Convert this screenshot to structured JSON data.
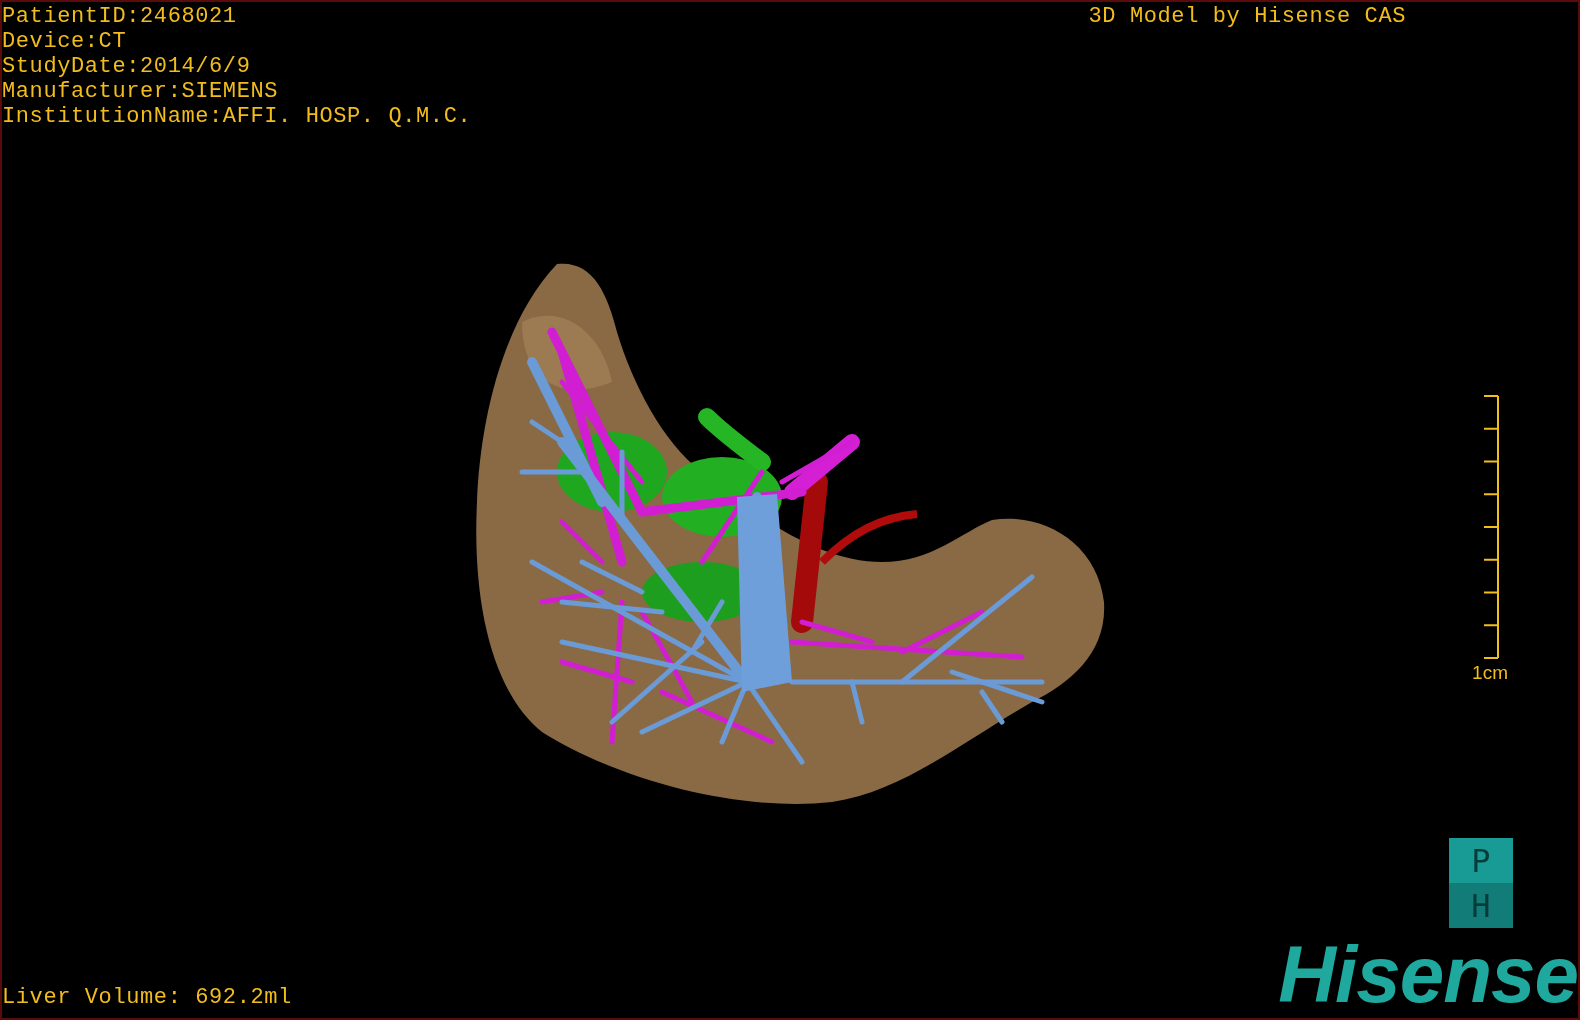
{
  "info_lines": [
    "PatientID:2468021",
    "Device:CT",
    "StudyDate:2014/6/9",
    "Manufacturer:SIEMENS",
    "InstitutionName:AFFI. HOSP. Q.M.C."
  ],
  "title": "3D Model by Hisense CAS",
  "scale_bar": {
    "label": "1cm"
  },
  "volume": "Liver Volume: 692.2ml",
  "logo": {
    "badge_top": "P",
    "badge_bottom": "H",
    "wordmark": "Hisense"
  }
}
